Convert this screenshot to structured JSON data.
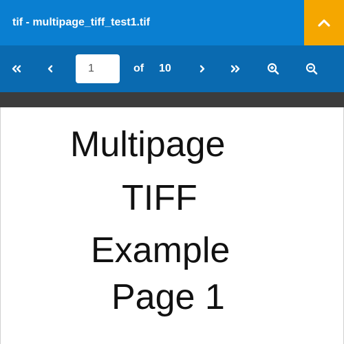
{
  "window": {
    "title": "tif - multipage_tiff_test1.tif",
    "accent_color": "#0a7fd1",
    "toolbar_color": "#0a6ab0",
    "collapse_button_color": "#f5a700"
  },
  "toolbar": {
    "first_page_icon": "double-chevron-left-icon",
    "prev_page_icon": "chevron-left-icon",
    "current_page": "1",
    "of_label": "of",
    "total_pages": "10",
    "next_page_icon": "chevron-right-icon",
    "last_page_icon": "double-chevron-right-icon",
    "zoom_in_icon": "zoom-in-icon",
    "zoom_out_icon": "zoom-out-icon",
    "collapse_icon": "chevron-up-icon"
  },
  "document": {
    "lines": [
      "Multipage",
      "TIFF",
      "Example",
      "Page 1"
    ]
  }
}
